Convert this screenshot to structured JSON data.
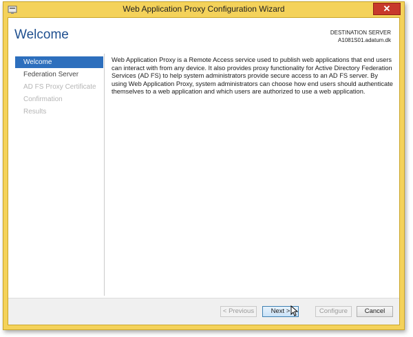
{
  "window": {
    "title": "Web Application Proxy Configuration Wizard",
    "close_label": "✕"
  },
  "header": {
    "page_title": "Welcome",
    "destination_label": "DESTINATION SERVER",
    "destination_value": "A1081S01.adatum.dk"
  },
  "sidebar": {
    "items": [
      {
        "label": "Welcome",
        "state": "active"
      },
      {
        "label": "Federation Server",
        "state": "enabled"
      },
      {
        "label": "AD FS Proxy Certificate",
        "state": "disabled"
      },
      {
        "label": "Confirmation",
        "state": "disabled"
      },
      {
        "label": "Results",
        "state": "disabled"
      }
    ]
  },
  "main": {
    "description": "Web Application Proxy is a Remote Access service used to publish web applications that end users can interact with from any device. It also provides proxy functionality for Active Directory Federation Services (AD FS) to help system administrators provide secure access to an AD FS server. By using Web Application Proxy, system administrators can choose how end users should authenticate themselves to a web application and which users are authorized to use a web application."
  },
  "footer": {
    "previous_label": "< Previous",
    "next_label": "Next >",
    "configure_label": "Configure",
    "cancel_label": "Cancel"
  },
  "colors": {
    "window_frame": "#f4d25a",
    "accent": "#2d6fbd",
    "title_text": "#1e4f8f"
  }
}
